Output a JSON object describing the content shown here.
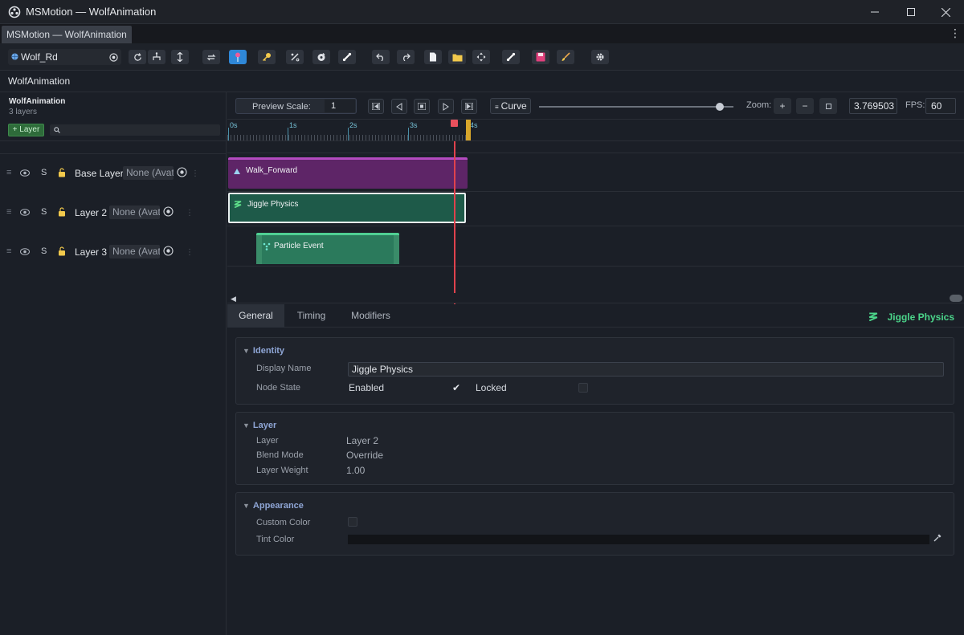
{
  "window": {
    "title": "MSMotion — WolfAnimation",
    "doc_tab": "MSMotion — WolfAnimation"
  },
  "toolbar": {
    "rig_name": "Wolf_Rd"
  },
  "header": {
    "title": "WolfAnimation"
  },
  "left_panel": {
    "title": "WolfAnimation",
    "subtitle": "3 layers",
    "add_layer_label": "+ Layer",
    "layers": [
      {
        "name": "Base Layer",
        "solo": "S",
        "avatar": "None (Avatar)"
      },
      {
        "name": "Layer 2",
        "solo": "S",
        "avatar": "None (Avatar)"
      },
      {
        "name": "Layer 3",
        "solo": "S",
        "avatar": "None (Avatar)"
      }
    ]
  },
  "timeline": {
    "preview_scale_label": "Preview Scale:",
    "preview_scale_value": "1",
    "curve_label": "Curve",
    "zoom_label": "Zoom:",
    "time_value": "3.769503",
    "fps_label": "FPS:",
    "fps_value": "60",
    "ruler_labels": [
      "0s",
      "1s",
      "2s",
      "3s",
      "4s"
    ],
    "clips": {
      "walk": "Walk_Forward",
      "jiggle": "Jiggle Physics",
      "particle": "Particle Event"
    }
  },
  "properties": {
    "tabs": [
      "General",
      "Timing",
      "Modifiers"
    ],
    "selected_name": "Jiggle Physics",
    "identity": {
      "title": "Identity",
      "display_name_label": "Display Name",
      "display_name_value": "Jiggle Physics",
      "node_state_label": "Node State",
      "enabled_label": "Enabled",
      "locked_label": "Locked"
    },
    "layer": {
      "title": "Layer",
      "layer_label": "Layer",
      "layer_value": "Layer 2",
      "blend_label": "Blend Mode",
      "blend_value": "Override",
      "weight_label": "Layer Weight",
      "weight_value": "1.00"
    },
    "appearance": {
      "title": "Appearance",
      "custom_color_label": "Custom Color",
      "tint_color_label": "Tint Color"
    }
  },
  "colors": {
    "accent_blue": "#2f88d8",
    "playhead": "#e0424d",
    "clip_walk": "#5e2567",
    "clip_jiggle": "#1e5a49",
    "clip_particle": "#2b7a5c",
    "selected_green": "#4bd58a"
  }
}
